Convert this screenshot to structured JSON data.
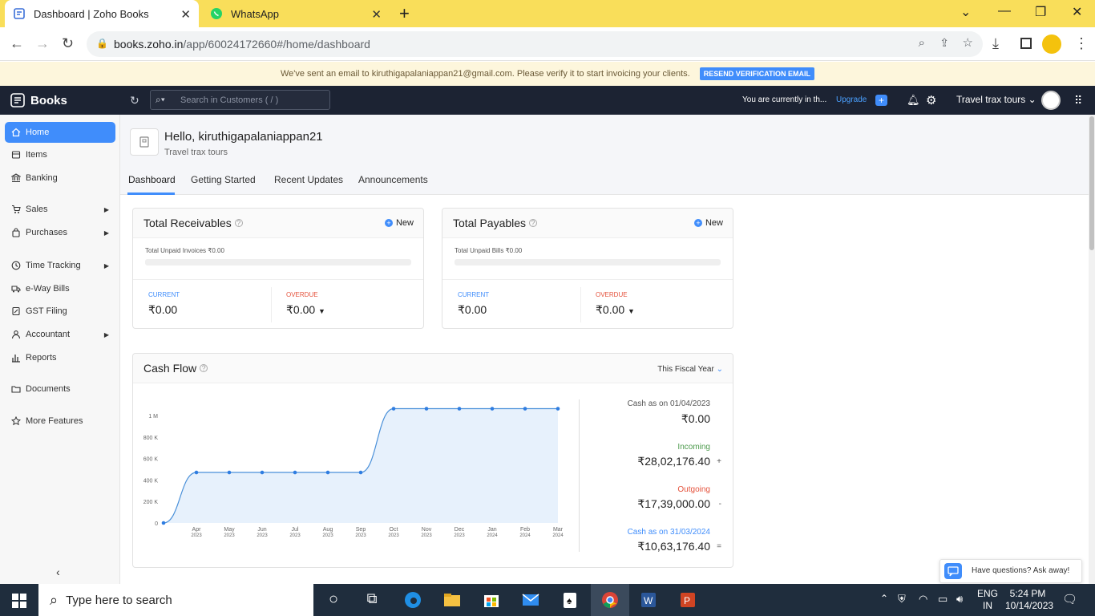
{
  "browser": {
    "tabs": [
      {
        "title": "Dashboard | Zoho Books",
        "active": true
      },
      {
        "title": "WhatsApp",
        "active": false
      }
    ],
    "url_host": "books.zoho.in",
    "url_path": "/app/60024172660#/home/dashboard"
  },
  "banner": {
    "message": "We've sent an email to kiruthigapalaniappan21@gmail.com. Please verify it to start invoicing your clients.",
    "button": "RESEND VERIFICATION EMAIL"
  },
  "header": {
    "brand": "Books",
    "search_placeholder": "Search in Customers ( / )",
    "currently": "You are currently in th...",
    "upgrade": "Upgrade",
    "org_name": "Travel trax tours"
  },
  "sidebar": {
    "items": [
      {
        "label": "Home",
        "icon": "home-icon"
      },
      {
        "label": "Items",
        "icon": "items-icon"
      },
      {
        "label": "Banking",
        "icon": "bank-icon"
      },
      {
        "label": "Sales",
        "icon": "cart-icon"
      },
      {
        "label": "Purchases",
        "icon": "bag-icon"
      },
      {
        "label": "Time Tracking",
        "icon": "clock-icon"
      },
      {
        "label": "e-Way Bills",
        "icon": "truck-icon"
      },
      {
        "label": "GST Filing",
        "icon": "gst-icon"
      },
      {
        "label": "Accountant",
        "icon": "person-icon"
      },
      {
        "label": "Reports",
        "icon": "chart-icon"
      },
      {
        "label": "Documents",
        "icon": "folder-icon"
      },
      {
        "label": "More Features",
        "icon": "star-icon"
      }
    ]
  },
  "hero": {
    "greeting": "Hello, kiruthigapalaniappan21",
    "org": "Travel trax tours",
    "tabs": [
      "Dashboard",
      "Getting Started",
      "Recent Updates",
      "Announcements"
    ]
  },
  "receivables": {
    "title": "Total Receivables",
    "new_label": "New",
    "unpaid": "Total Unpaid Invoices ₹0.00",
    "current_label": "CURRENT",
    "current_value": "₹0.00",
    "overdue_label": "OVERDUE",
    "overdue_value": "₹0.00"
  },
  "payables": {
    "title": "Total Payables",
    "new_label": "New",
    "unpaid": "Total Unpaid Bills ₹0.00",
    "current_label": "CURRENT",
    "current_value": "₹0.00",
    "overdue_label": "OVERDUE",
    "overdue_value": "₹0.00"
  },
  "cashflow": {
    "title": "Cash Flow",
    "period": "This Fiscal Year",
    "opening_label": "Cash as on 01/04/2023",
    "opening_value": "₹0.00",
    "incoming_label": "Incoming",
    "incoming_value": "₹28,02,176.40",
    "incoming_sign": "+",
    "outgoing_label": "Outgoing",
    "outgoing_value": "₹17,39,000.00",
    "outgoing_sign": "-",
    "closing_label": "Cash as on 31/03/2024",
    "closing_value": "₹10,63,176.40",
    "closing_sign": "="
  },
  "chart_data": {
    "type": "area",
    "x": [
      "",
      "Apr 2023",
      "May 2023",
      "Jun 2023",
      "Jul 2023",
      "Aug 2023",
      "Sep 2023",
      "Oct 2023",
      "Nov 2023",
      "Dec 2023",
      "Jan 2024",
      "Feb 2024",
      "Mar 2024"
    ],
    "x_top": [
      "",
      "Apr",
      "May",
      "Jun",
      "Jul",
      "Aug",
      "Sep",
      "Oct",
      "Nov",
      "Dec",
      "Jan",
      "Feb",
      "Mar"
    ],
    "x_bottom": [
      "",
      "2023",
      "2023",
      "2023",
      "2023",
      "2023",
      "2023",
      "2023",
      "2023",
      "2023",
      "2024",
      "2024",
      "2024"
    ],
    "values": [
      0,
      470000,
      470000,
      470000,
      470000,
      470000,
      470000,
      1063176.4,
      1063176.4,
      1063176.4,
      1063176.4,
      1063176.4,
      1063176.4
    ],
    "yticks": [
      0,
      200000,
      400000,
      600000,
      800000,
      1000000
    ],
    "ytick_labels": [
      "0",
      "200 K",
      "400 K",
      "600 K",
      "800 K",
      "1 M"
    ],
    "ylim": [
      0,
      1000000
    ],
    "colors": {
      "line": "#4a90d9",
      "fill": "#e7f1fc",
      "point": "#2f7de1"
    }
  },
  "help_widget": {
    "text": "Have questions? Ask away!"
  },
  "taskbar": {
    "search_placeholder": "Type here to search",
    "lang_top": "ENG",
    "lang_bottom": "IN",
    "time": "5:24 PM",
    "date": "10/14/2023"
  }
}
